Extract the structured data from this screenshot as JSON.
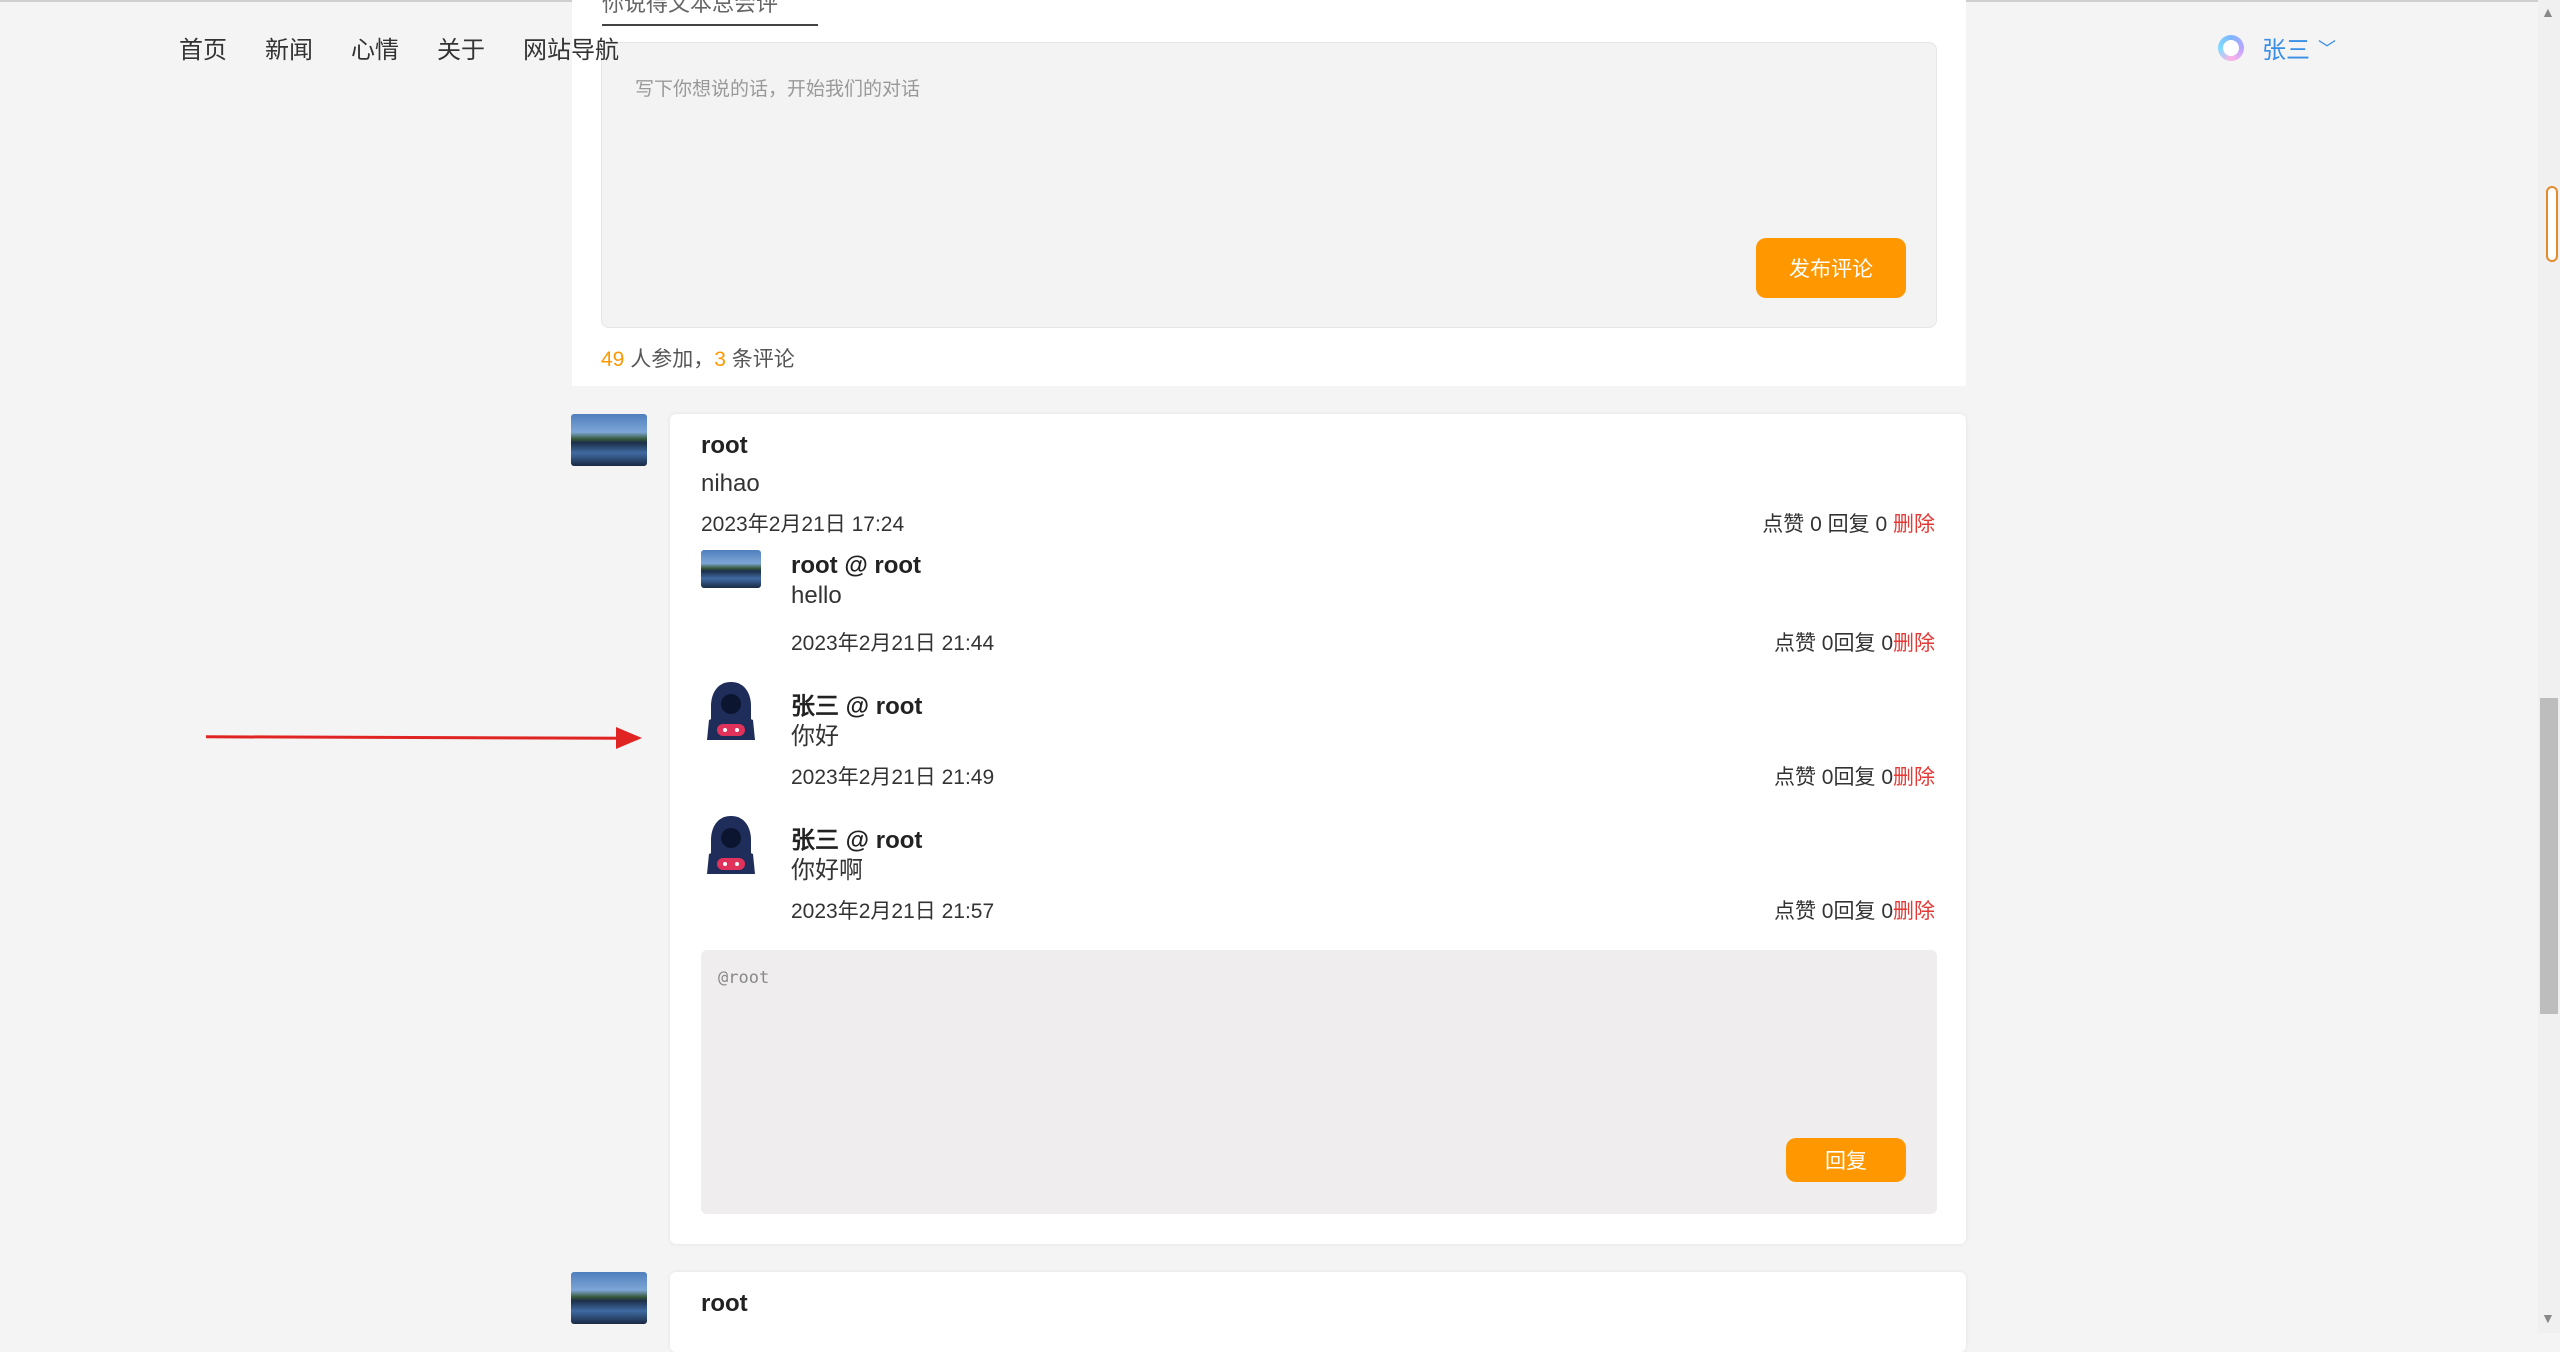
{
  "nav": {
    "items": [
      "首页",
      "新闻",
      "心情",
      "关于",
      "网站导航"
    ]
  },
  "user": {
    "name": "张三"
  },
  "editor": {
    "tab_text": "你说得文本总会评",
    "placeholder": "写下你想说的话，开始我们的对话",
    "publish": "发布评论",
    "participants": "49",
    "participants_suffix": " 人参加，",
    "comments": "3",
    "comments_suffix": " 条评论"
  },
  "comment": {
    "author": "root",
    "text": "nihao",
    "date": "2023年2月21日 17:24",
    "actions": "点赞 0 回复 0 ",
    "delete": "删除",
    "replies": [
      {
        "author": "root @ root",
        "text": "hello",
        "date": "2023年2月21日 21:44",
        "actions": "点赞 0回复 0",
        "delete": "删除"
      },
      {
        "author": "张三 @ root",
        "text": "你好",
        "date": "2023年2月21日 21:49",
        "actions": "点赞 0回复 0",
        "delete": "删除"
      },
      {
        "author": "张三 @ root",
        "text": "你好啊",
        "date": "2023年2月21日 21:57",
        "actions": "点赞 0回复 0",
        "delete": "删除"
      }
    ],
    "reply_placeholder": "@root",
    "reply_button": "回复"
  },
  "comment2": {
    "author": "root"
  }
}
